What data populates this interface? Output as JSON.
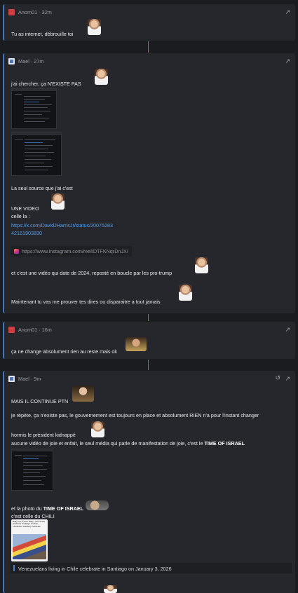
{
  "posts": [
    {
      "author": "Anom01 · 32m",
      "lines": [
        "Tu as internet, débrouille toi"
      ]
    },
    {
      "author": "Mael · 27m",
      "lines": {
        "l1": "j'ai chercher, ça N'EXISTE PAS",
        "l2": "La seul source que j'ai c'est",
        "l3": "UNE VIDEO",
        "l4": "celle la :",
        "link1": "https://x.com/DavidJHarrisJr/status/20075283",
        "link2": "42161903830",
        "embed": "https://www.instagram.com/reel/DTFKNqrDnJX/",
        "l5": "et c'est une vidéo qui date de 2024, reposté en boucle par les pro-trump",
        "l6": "Maintenant tu vas me prouver tes dires ou disparaitre a tout jamais"
      }
    },
    {
      "author": "Anom01 · 16m",
      "lines": [
        "ça ne change absolument rien au reste mais ok"
      ]
    },
    {
      "author": "Mael · 9m",
      "lines": {
        "l1": "MAIS IL CONTINUE PTN",
        "l2": "je répète, ça n'existe pas, le gouvernement est toujours en place et absolument RIEN n'a pour l'instant changer",
        "l3": "hormis le président kidnappé",
        "l4a": "aucune vidéo de joie et enfait, le seul média qui parle de manifestation de joie, c'est le ",
        "l4b": "TIME OF ISRAEL",
        "l5a": "et la photo du ",
        "l5b": "TIME OF ISRAEL",
        "l6": "c'est celle du CHILI",
        "quote": "Venezuelans living in Chile celebrate in Santiago on January 3, 2026",
        "news_headline": "Rally pas le face Rally | Venezuela celebrate Santiago inaction, manifester solidarity celebrate"
      }
    }
  ],
  "icons": {
    "share": "share-arrow-icon",
    "history": "history-icon",
    "instagram": "instagram-icon"
  },
  "colors": {
    "accent": "#3c78c8",
    "link": "#5a9ee8",
    "card": "#26272c",
    "bg": "#1b1c20"
  }
}
